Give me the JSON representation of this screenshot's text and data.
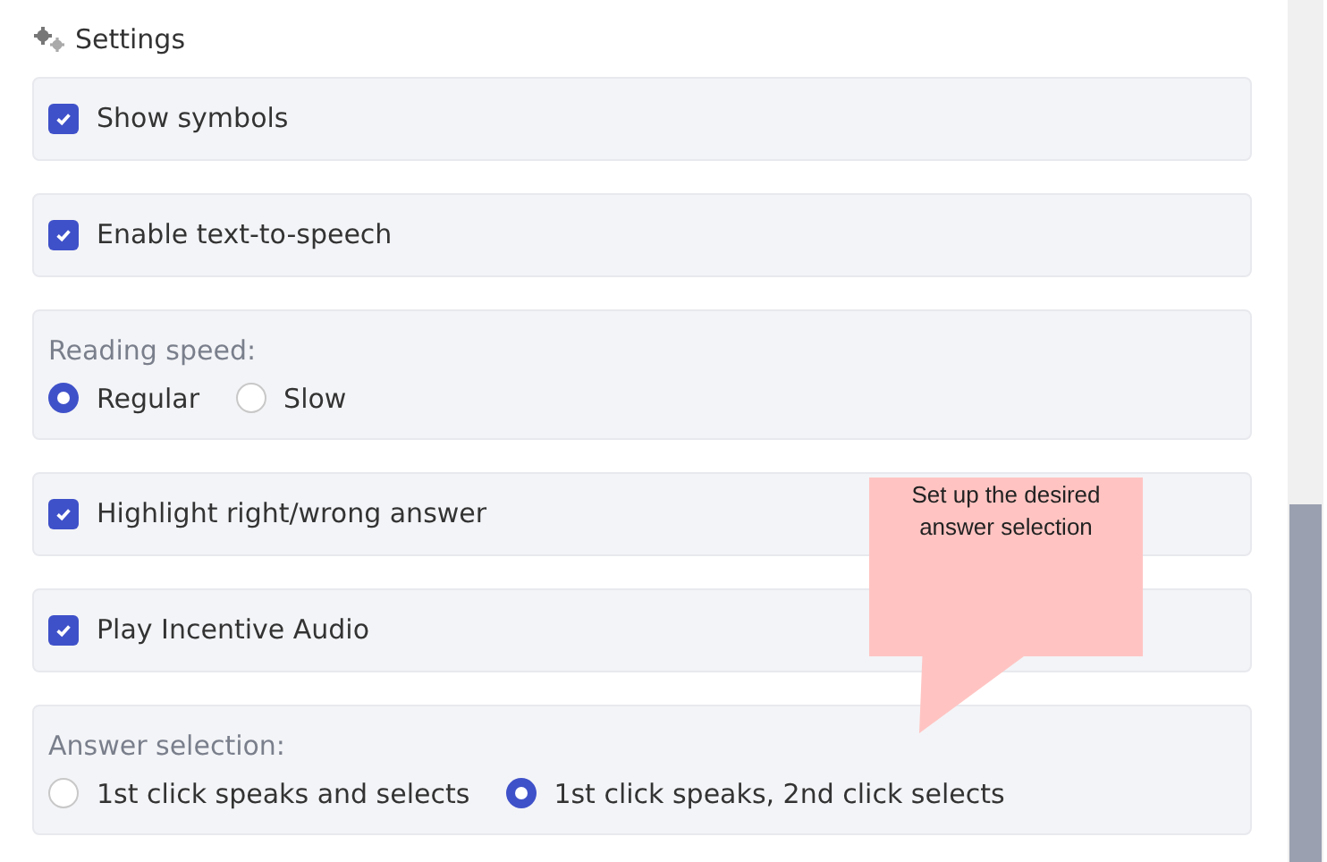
{
  "title": "Settings",
  "settings": [
    {
      "kind": "checkbox",
      "label": "Show symbols",
      "checked": true
    },
    {
      "kind": "checkbox",
      "label": "Enable text-to-speech",
      "checked": true
    },
    {
      "kind": "radio-group",
      "label": "Reading speed:",
      "options": [
        {
          "label": "Regular",
          "selected": true
        },
        {
          "label": "Slow",
          "selected": false
        }
      ]
    },
    {
      "kind": "checkbox",
      "label": "Highlight right/wrong answer",
      "checked": true
    },
    {
      "kind": "checkbox",
      "label": "Play Incentive Audio",
      "checked": true
    },
    {
      "kind": "radio-group",
      "label": "Answer selection:",
      "options": [
        {
          "label": "1st click speaks and selects",
          "selected": false
        },
        {
          "label": "1st click speaks, 2nd click selects",
          "selected": true
        }
      ]
    }
  ],
  "callout": {
    "text": "Set up the desired answer selection"
  }
}
